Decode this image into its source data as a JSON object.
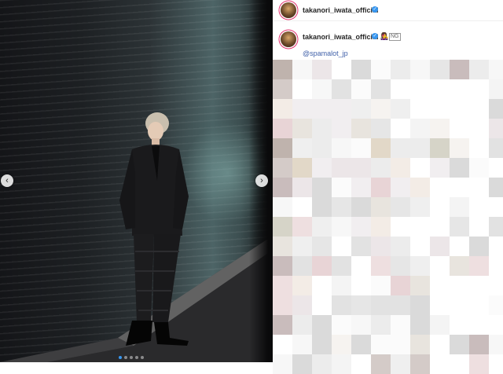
{
  "post": {
    "username": "takanori_iwata_official",
    "verified_badge": "verified-check-icon",
    "caption_mention": "@spamalot_jp",
    "caption_emojis": [
      "👩‍🎤",
      "🆖"
    ]
  },
  "carousel": {
    "prev_arrow": "‹",
    "next_arrow": "›",
    "slide_count": 5,
    "active_slide": 1
  },
  "colors": {
    "verified": "#3897f0",
    "mention": "#3f5fa8",
    "username": "#262626"
  }
}
